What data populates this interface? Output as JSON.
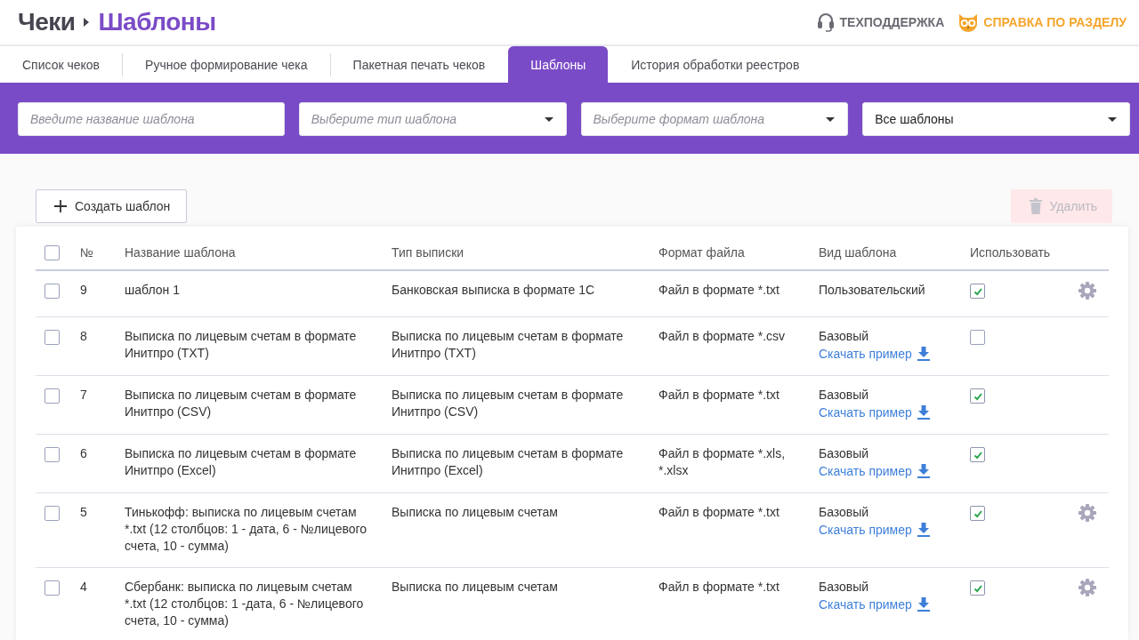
{
  "breadcrumb": {
    "parent": "Чеки",
    "current": "Шаблоны"
  },
  "header_links": [
    {
      "kind": "support",
      "label": "ТЕХПОДДЕРЖКА"
    },
    {
      "kind": "help",
      "label": "СПРАВКА ПО РАЗДЕЛУ"
    }
  ],
  "tabs": [
    {
      "label": "Список чеков",
      "selected": false
    },
    {
      "label": "Ручное формирование чека",
      "selected": false
    },
    {
      "label": "Пакетная печать чеков",
      "selected": false
    },
    {
      "label": "Шаблоны",
      "selected": true
    },
    {
      "label": "История обработки реестров",
      "selected": false
    }
  ],
  "filters": [
    {
      "kind": "input",
      "placeholder": "Введите название шаблона"
    },
    {
      "kind": "select",
      "placeholder": "Выберите тип шаблона"
    },
    {
      "kind": "select",
      "placeholder": "Выберите формат шаблона"
    },
    {
      "kind": "select",
      "value": "Все шаблоны"
    }
  ],
  "actions": [
    {
      "kind": "create",
      "label": "Создать шаблон",
      "disabled": false
    },
    {
      "kind": "delete",
      "label": "Удалить",
      "disabled": true
    }
  ],
  "table": {
    "select_all": {
      "checked": false
    },
    "columns": [
      "№",
      "Название шаблона",
      "Тип выписки",
      "Формат файла",
      "Вид шаблона",
      "Использовать"
    ],
    "rows": [
      {
        "selected": false,
        "number": "9",
        "name": "шаблон 1",
        "statement_type": "Банковская выписка в формате 1С",
        "file_format": "Файл в формате *.txt",
        "template_kind": "Пользовательский",
        "in_use": true,
        "settings": true
      },
      {
        "selected": false,
        "number": "8",
        "name": "Выписка по лицевым счетам в формате Инитпро (TXT)",
        "statement_type": "Выписка по лицевым счетам в формате Инитпро (TXT)",
        "file_format": "Файл в формате *.csv",
        "template_kind": "Базовый",
        "sample_link": "Скачать пример",
        "in_use": false,
        "settings": false
      },
      {
        "selected": false,
        "number": "7",
        "name": "Выписка по лицевым счетам в формате Инитпро (CSV)",
        "statement_type": "Выписка по лицевым счетам в формате Инитпро (CSV)",
        "file_format": "Файл в формате *.txt",
        "template_kind": "Базовый",
        "sample_link": "Скачать пример",
        "in_use": true,
        "settings": false
      },
      {
        "selected": false,
        "number": "6",
        "name": "Выписка по лицевым счетам в формате Инитпро (Excel)",
        "statement_type": "Выписка по лицевым счетам в формате Инитпро (Excel)",
        "file_format": "Файл в формате *.xls, *.xlsx",
        "template_kind": "Базовый",
        "sample_link": "Скачать пример",
        "in_use": true,
        "settings": false
      },
      {
        "selected": false,
        "number": "5",
        "name": "Тинькофф: выписка по лицевым счетам *.txt (12 столбцов: 1 - дата, 6 - №лицевого счета, 10 - сумма)",
        "statement_type": "Выписка по лицевым счетам",
        "file_format": "Файл в формате *.txt",
        "template_kind": "Базовый",
        "sample_link": "Скачать пример",
        "in_use": true,
        "settings": true
      },
      {
        "selected": false,
        "number": "4",
        "name": "Сбербанк: выписка по лицевым счетам *.txt (12 столбцов: 1 -дата, 6 - №лицевого счета, 10 - сумма)",
        "statement_type": "Выписка по лицевым счетам",
        "file_format": "Файл в формате *.txt",
        "template_kind": "Базовый",
        "sample_link": "Скачать пример",
        "in_use": true,
        "settings": true
      }
    ]
  }
}
